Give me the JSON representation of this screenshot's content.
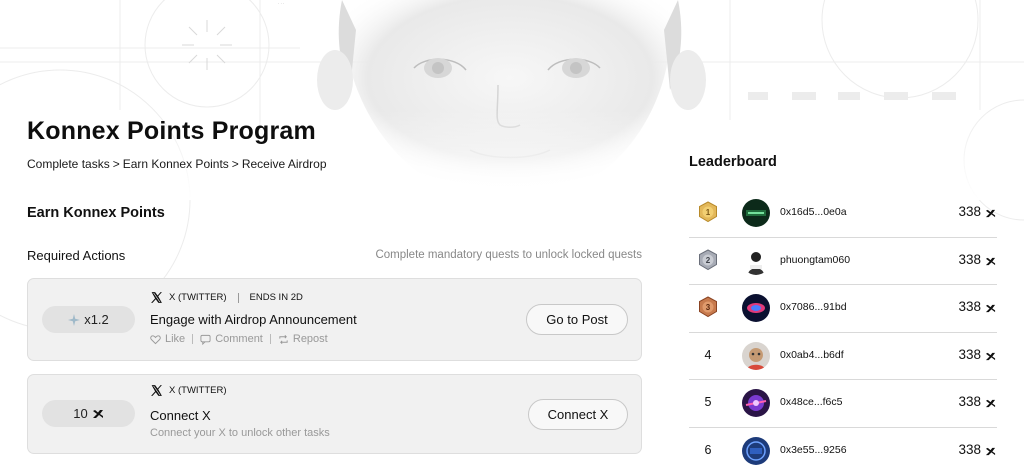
{
  "header": {
    "title": "Konnex Points Program",
    "breadcrumb": [
      "Complete tasks",
      "Earn Konnex Points",
      "Receive Airdrop"
    ],
    "breadcrumb_sep": ">"
  },
  "earn": {
    "title": "Earn Konnex Points",
    "required_title": "Required Actions",
    "required_hint": "Complete mandatory quests to unlock locked quests"
  },
  "tasks": [
    {
      "reward": "x1.2",
      "platform": "X (TWITTER)",
      "ends": "ENDS IN 2D",
      "name": "Engage with Airdrop Announcement",
      "actions": [
        "Like",
        "Comment",
        "Repost"
      ],
      "button": "Go to Post"
    },
    {
      "reward": "10",
      "platform": "X (TWITTER)",
      "name": "Connect X",
      "subtitle": "Connect your X to unlock other tasks",
      "button": "Connect X"
    }
  ],
  "leaderboard": {
    "title": "Leaderboard",
    "rows": [
      {
        "rank": "1",
        "name": "0x16d5...0e0a",
        "points": "338"
      },
      {
        "rank": "2",
        "name": "phuongtam060",
        "points": "338"
      },
      {
        "rank": "3",
        "name": "0x7086...91bd",
        "points": "338"
      },
      {
        "rank": "4",
        "name": "0x0ab4...b6df",
        "points": "338"
      },
      {
        "rank": "5",
        "name": "0x48ce...f6c5",
        "points": "338"
      },
      {
        "rank": "6",
        "name": "0x3e55...9256",
        "points": "338"
      }
    ]
  },
  "colors": {
    "gold": "#c9962e",
    "silver": "#7a7f8a",
    "bronze": "#a8582f",
    "card_bg": "#f1f1f1"
  }
}
